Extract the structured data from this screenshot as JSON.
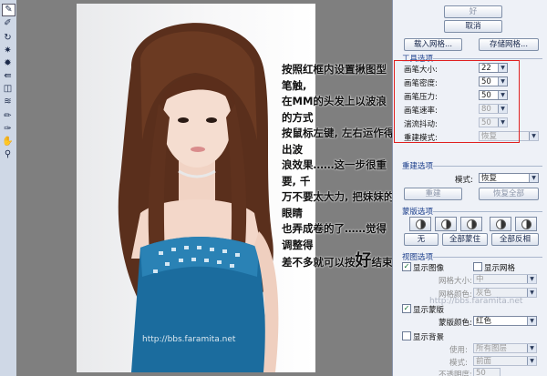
{
  "panel": {
    "top_button": "好",
    "cancel_button": "取消",
    "load_mesh": "载入网格...",
    "save_mesh": "存储网格...",
    "tool_options": {
      "title": "工具选项",
      "brush_size": {
        "label": "画笔大小:",
        "value": "22"
      },
      "brush_density": {
        "label": "画笔密度:",
        "value": "50"
      },
      "brush_pressure": {
        "label": "画笔压力:",
        "value": "50"
      },
      "brush_rate": {
        "label": "画笔速率:",
        "value": "80"
      },
      "turbulent_jitter": {
        "label": "湍流抖动:",
        "value": "50"
      },
      "reconstruct_mode": {
        "label": "重建模式:",
        "value": "恢复"
      }
    },
    "reconstruct_options": {
      "title": "重建选项",
      "mode_label": "模式:",
      "mode_value": "恢复",
      "reconstruct_button": "重建",
      "restore_all_button": "恢复全部"
    },
    "mask_options": {
      "title": "蒙版选项",
      "none_button": "无",
      "mask_all_button": "全部蒙住",
      "invert_all_button": "全部反相"
    },
    "view_options": {
      "title": "视图选项",
      "show_image": "显示图像",
      "show_mesh": "显示网格",
      "mesh_size_label": "网格大小:",
      "mesh_size_value": "中",
      "mesh_color_label": "网格颜色:",
      "mesh_color_value": "灰色",
      "show_mask": "显示蒙版",
      "mask_color_label": "蒙版颜色:",
      "mask_color_value": "红色",
      "show_backdrop": "显示背景",
      "use_label": "使用:",
      "use_value": "所有图层",
      "mode_label": "模式:",
      "mode_value": "前面",
      "opacity_label": "不透明度:",
      "opacity_value": "50"
    }
  },
  "annotation": {
    "lines": [
      "按照红框内设置揪图型笔触,",
      "在MM的头发上以波浪的方式",
      "按鼠标左键, 左右运作得出波",
      "浪效果……这一步很重要, 千",
      "万不要太大力, 把妹妹的眼睛",
      "也弄成卷的了……觉得调整得"
    ],
    "last_line_prefix": "差不多就可以按",
    "last_line_big": "好",
    "last_line_suffix": "结束"
  },
  "watermark": {
    "url": "http://bbs.faramita.net",
    "url2": "http://bbs.faramita.net"
  },
  "colors": {
    "highlight_box": "#e02020",
    "panel_bg": "#eef1f7",
    "section_title": "#1c3f8c",
    "dress": "#1b6c9e"
  },
  "toolbar_icons": [
    "forward-warp-icon",
    "reconstruct-icon",
    "twirl-icon",
    "pucker-icon",
    "bloat-icon",
    "push-left-icon",
    "mirror-icon",
    "turbulence-icon",
    "freeze-mask-icon",
    "thaw-mask-icon",
    "hand-icon",
    "zoom-icon"
  ]
}
